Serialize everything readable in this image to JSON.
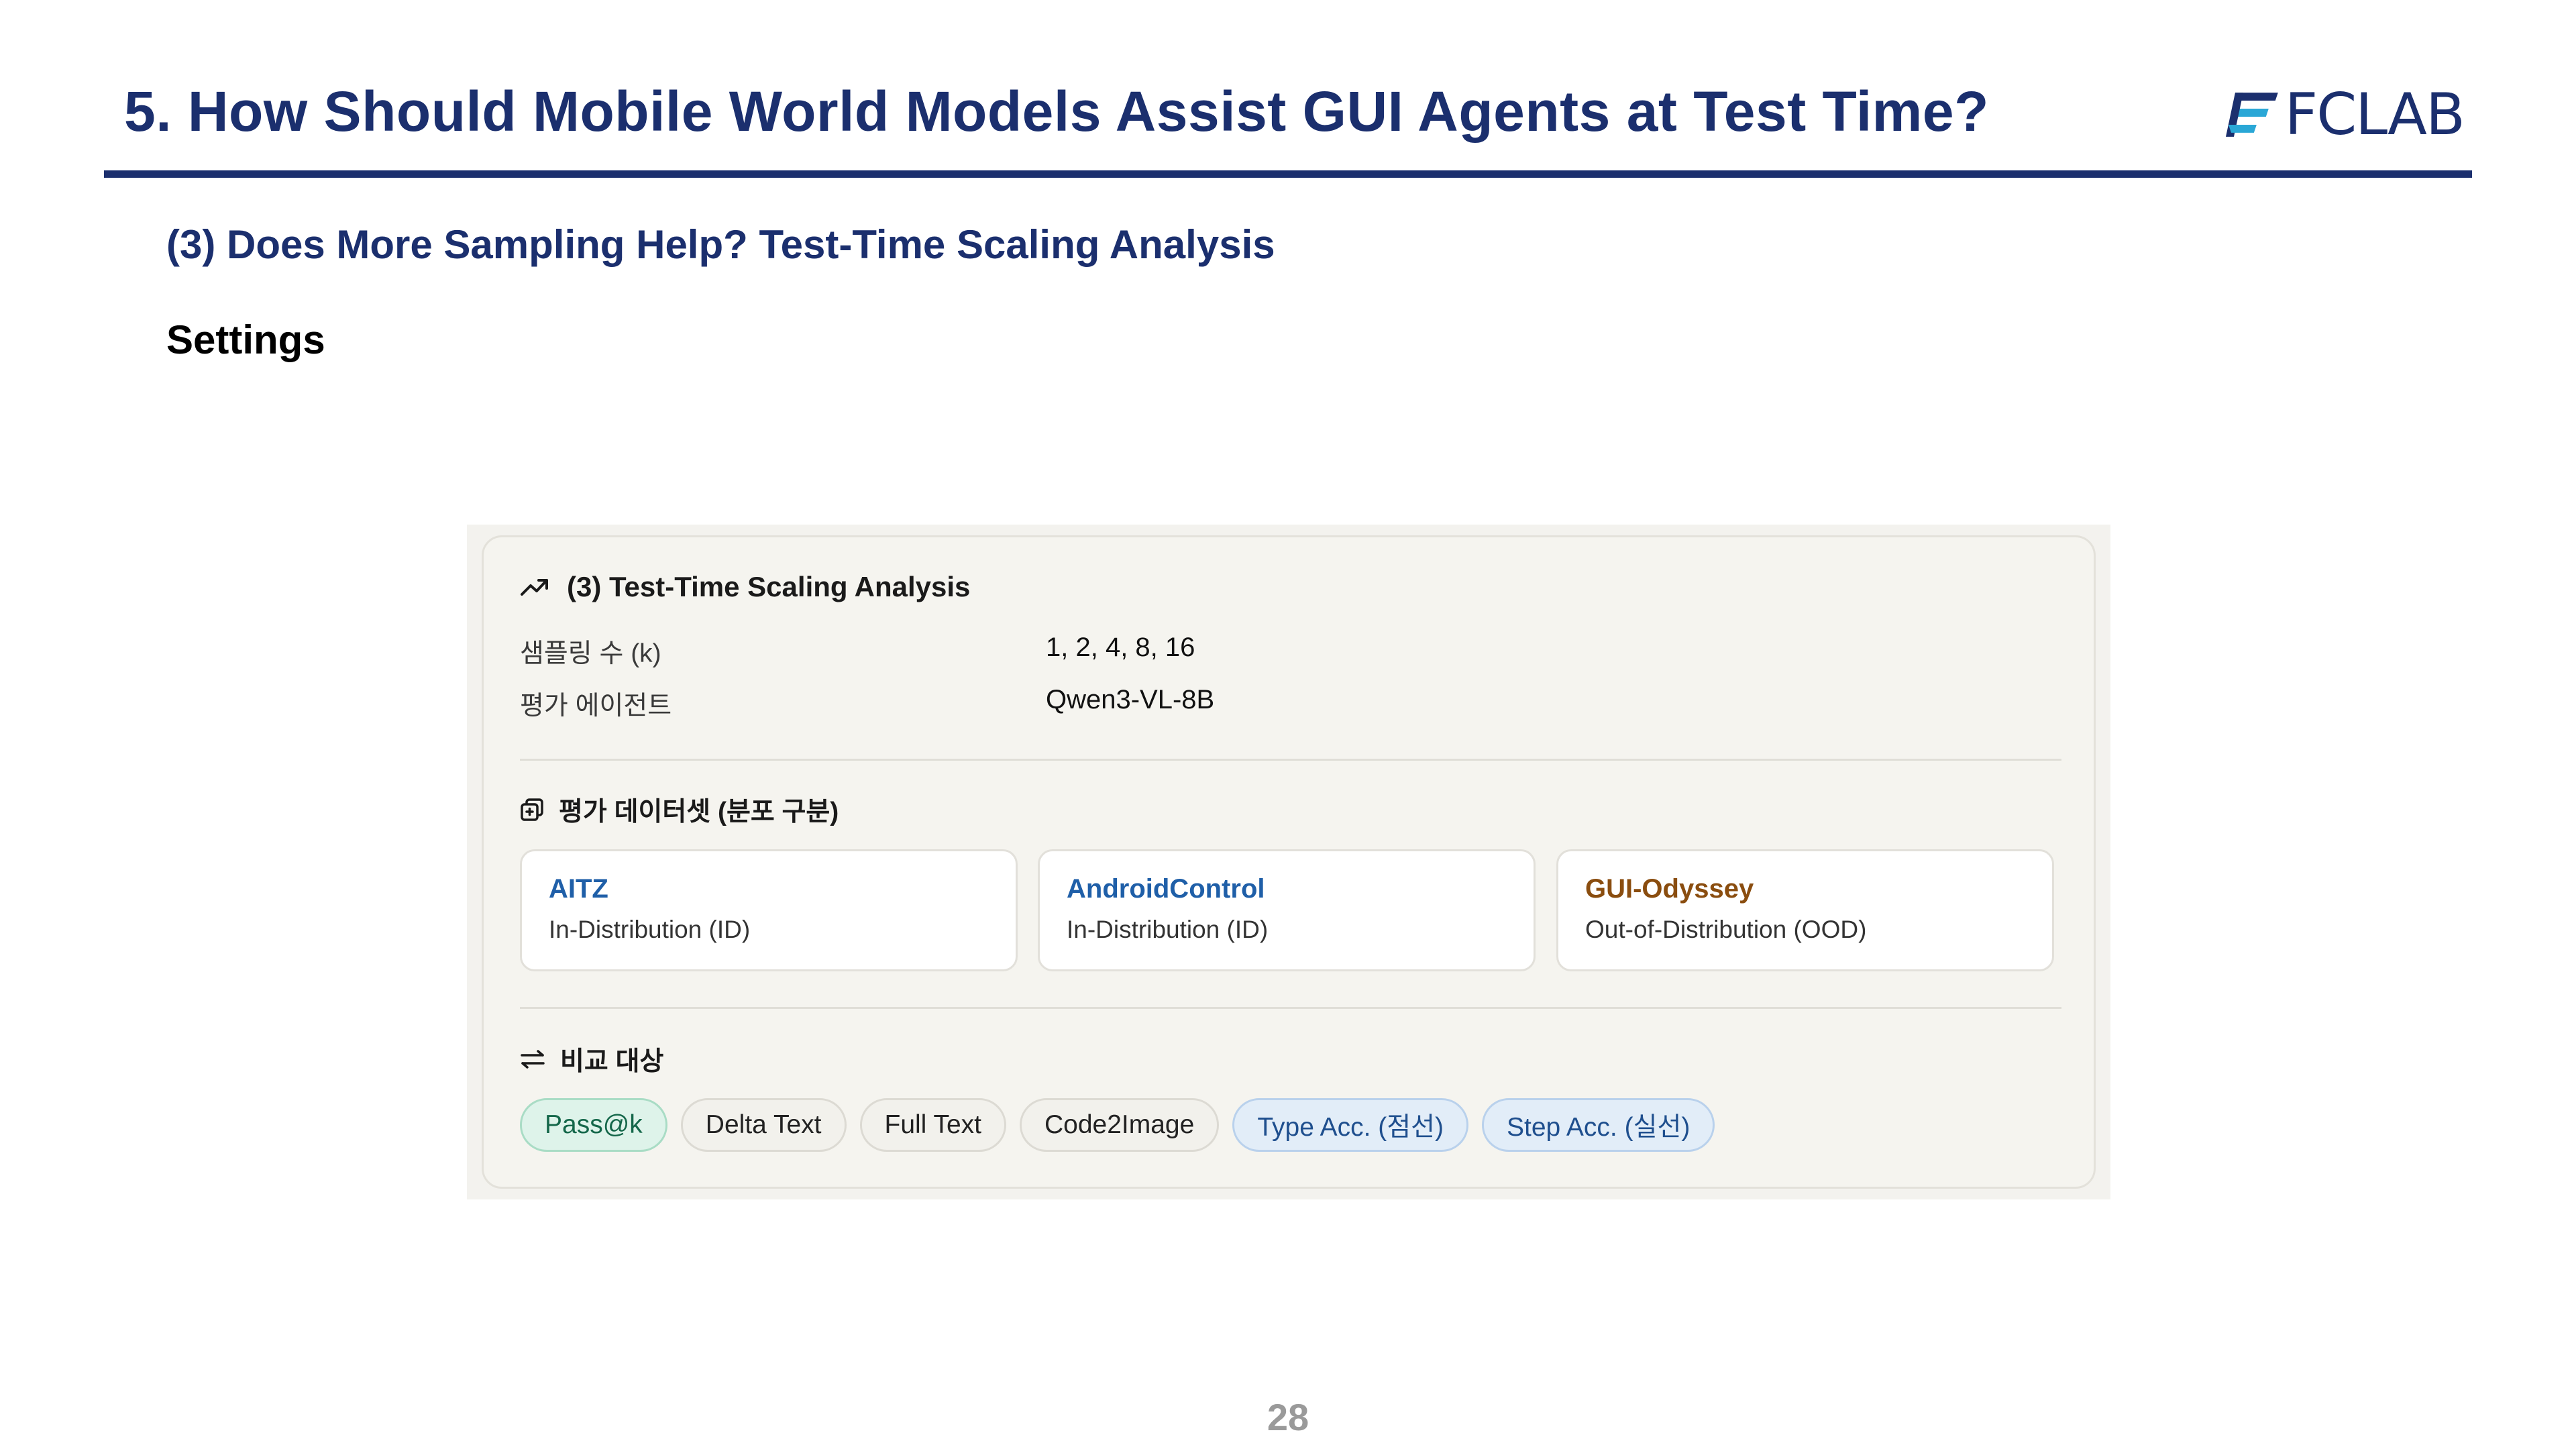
{
  "slide": {
    "title": "5. How Should Mobile World Models Assist GUI Agents at Test Time?",
    "logo_text": "FCLAB",
    "subtitle": "(3) Does More Sampling Help? Test-Time Scaling Analysis",
    "settings_heading": "Settings",
    "page_number": "28"
  },
  "panel": {
    "title_icon": "trending-up-icon",
    "title": "(3) Test-Time Scaling Analysis",
    "rows": [
      {
        "key": "샘플링 수 (k)",
        "value": "1, 2, 4, 8, 16"
      },
      {
        "key": "평가 에이전트",
        "value": "Qwen3-VL-8B"
      }
    ],
    "datasets_icon": "dataset-icon",
    "datasets_heading": "평가 데이터셋 (분포 구분)",
    "datasets": [
      {
        "name": "AITZ",
        "desc": "In-Distribution (ID)",
        "color": "#1f5fa8"
      },
      {
        "name": "AndroidControl",
        "desc": "In-Distribution (ID)",
        "color": "#1f5fa8"
      },
      {
        "name": "GUI-Odyssey",
        "desc": "Out-of-Distribution (OOD)",
        "color": "#8a4d0f"
      }
    ],
    "compare_icon": "swap-arrows-icon",
    "compare_heading": "비교 대상",
    "chips": [
      {
        "label": "Pass@k",
        "style": "green"
      },
      {
        "label": "Delta Text",
        "style": "neutral"
      },
      {
        "label": "Full Text",
        "style": "neutral"
      },
      {
        "label": "Code2Image",
        "style": "neutral"
      },
      {
        "label": "Type Acc. (점선)",
        "style": "blue"
      },
      {
        "label": "Step Acc. (실선)",
        "style": "blue"
      }
    ]
  },
  "colors": {
    "navy": "#1b2f6e",
    "logo_accent": "#2aa7d6"
  }
}
